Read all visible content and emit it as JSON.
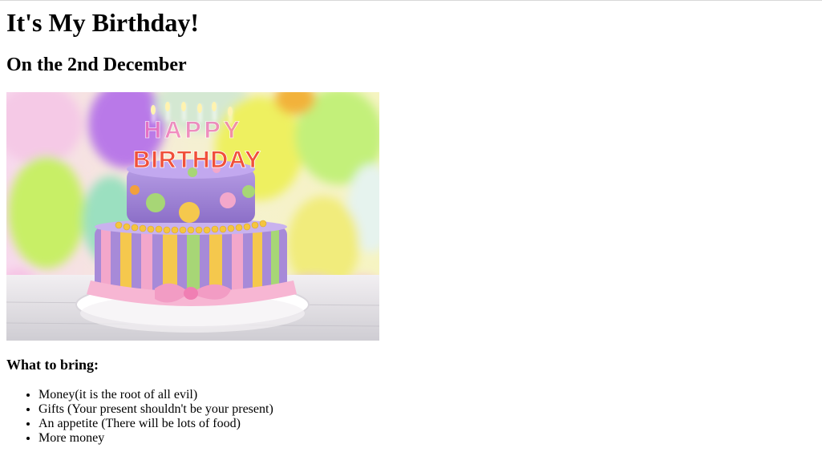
{
  "heading": "It's My Birthday!",
  "subheading": "On the 2nd December",
  "image": {
    "alt": "Birthday cake",
    "topper_line1": "HAPPY",
    "topper_line2": "BIRTHDAY",
    "colors": {
      "balloon_purple": "#b979e8",
      "balloon_yellow": "#f2ee62",
      "balloon_green": "#c3f07a",
      "cake_lilac": "#a78ad8",
      "stripe_green": "#a7d676",
      "stripe_yellow": "#f5c84d",
      "stripe_pink": "#f3a7cb",
      "dot_orange": "#f2a03d"
    }
  },
  "bring": {
    "title": "What to bring:",
    "items": [
      "Money(it is the root of all evil)",
      "Gifts (Your present shouldn't be your present)",
      "An appetite (There will be lots of food)",
      "More money"
    ]
  }
}
